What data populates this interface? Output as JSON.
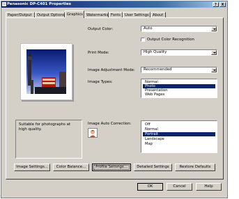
{
  "window": {
    "title": "Panasonic DP-C401 Properties",
    "help_btn": "?",
    "close_btn": "X"
  },
  "tabs": [
    "Paper/Output",
    "Output Options",
    "Graphics",
    "Watermarks",
    "Fonts",
    "User Settings",
    "About"
  ],
  "active_tab": "Graphics",
  "output_color": {
    "label": "Output Color:",
    "value": "Auto"
  },
  "color_recognition": {
    "label": "Output Color Recognition",
    "checked": false
  },
  "print_mode": {
    "label": "Print Mode:",
    "value": "High Quality"
  },
  "image_adjustment_mode": {
    "label": "Image Adjustment Mode:",
    "value": "Recommended"
  },
  "image_types": {
    "label": "Image Types:",
    "items": [
      "Normal",
      "Photo",
      "Presentation",
      "Web Pages"
    ],
    "selected": "Photo"
  },
  "description": "Suitable for photographs at high quality.",
  "image_auto_correction": {
    "label": "Image Auto Correction:",
    "items": [
      "Off",
      "Normal",
      "Portrait",
      "Landscape",
      "Map"
    ],
    "selected": "Portrait"
  },
  "buttons": {
    "image_settings": "Image Settings...",
    "color_balance": "Color Balance...",
    "profile_settings": "Profile Settings...",
    "detailed_settings": "Detailed Settings",
    "restore_defaults": "Restore Defaults"
  },
  "dialog_buttons": {
    "ok": "OK",
    "cancel": "Cancel",
    "help": "Help"
  },
  "colors": {
    "title_bar": "#0a246a",
    "selection": "#0a246a",
    "face": "#d4d0c8"
  }
}
